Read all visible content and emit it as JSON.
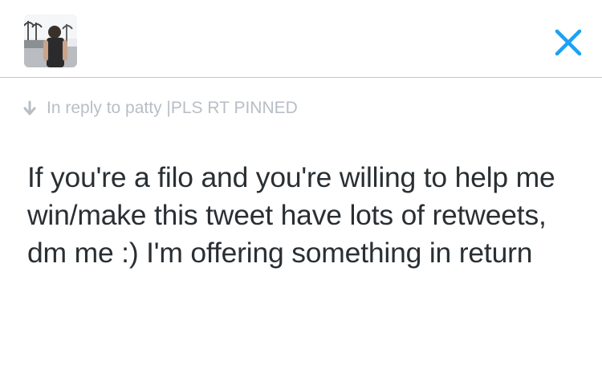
{
  "header": {
    "avatar_icon": "user-avatar-photo",
    "close_icon": "close-x-icon",
    "accent_color": "#1da1f2"
  },
  "reply": {
    "icon": "arrow-down-icon",
    "text": "In reply to patty |PLS RT PINNED"
  },
  "tweet": {
    "text": "If you're a filo and you're willing to help me win/make this tweet have lots of retweets, dm me :) I'm offering something in return"
  }
}
